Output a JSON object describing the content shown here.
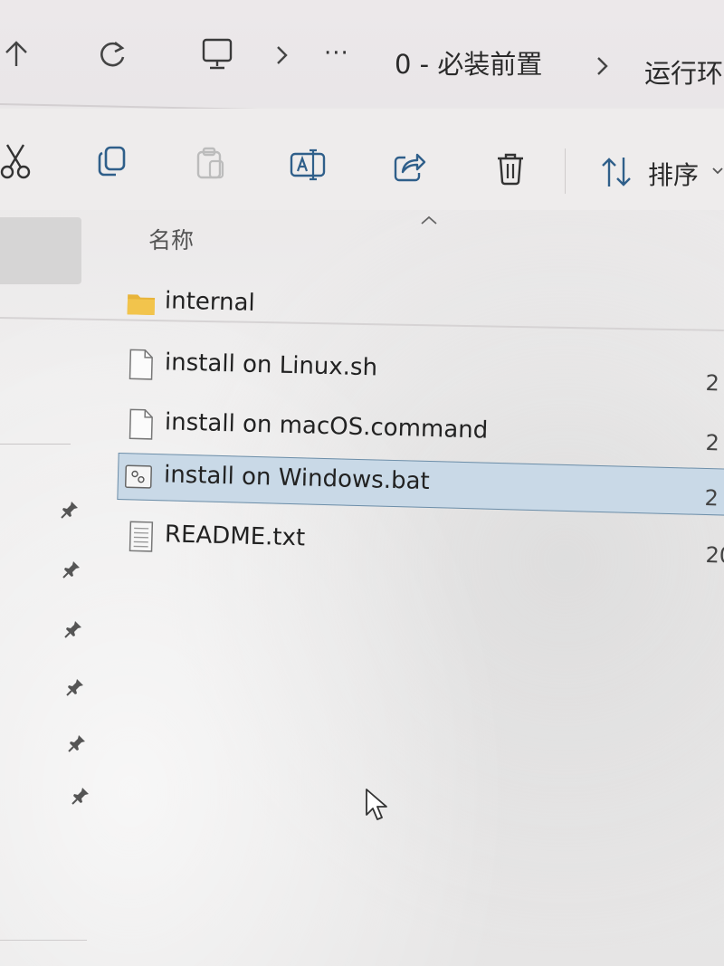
{
  "address_bar": {
    "breadcrumb": [
      "0 - 必装前置",
      "运行环"
    ],
    "overflow": "···",
    "icons": [
      "up-arrow-icon",
      "refresh-icon",
      "this-pc-icon"
    ]
  },
  "command_bar": {
    "actions": [
      "cut-icon",
      "copy-icon",
      "paste-icon",
      "rename-icon",
      "share-icon",
      "delete-icon"
    ],
    "sort_label": "排序"
  },
  "list": {
    "column_name": "名称",
    "items": [
      {
        "name": "internal",
        "type": "folder",
        "date": ""
      },
      {
        "name": "install on Linux.sh",
        "type": "file",
        "date": "2"
      },
      {
        "name": "install on macOS.command",
        "type": "file",
        "date": "2"
      },
      {
        "name": "install on Windows.bat",
        "type": "batch",
        "date": "2",
        "selected": true
      },
      {
        "name": "README.txt",
        "type": "text",
        "date": "20"
      }
    ]
  },
  "colors": {
    "selection": "#c9d9e7",
    "selection_border": "#6d8ea8",
    "folder": "#e8b43a"
  }
}
